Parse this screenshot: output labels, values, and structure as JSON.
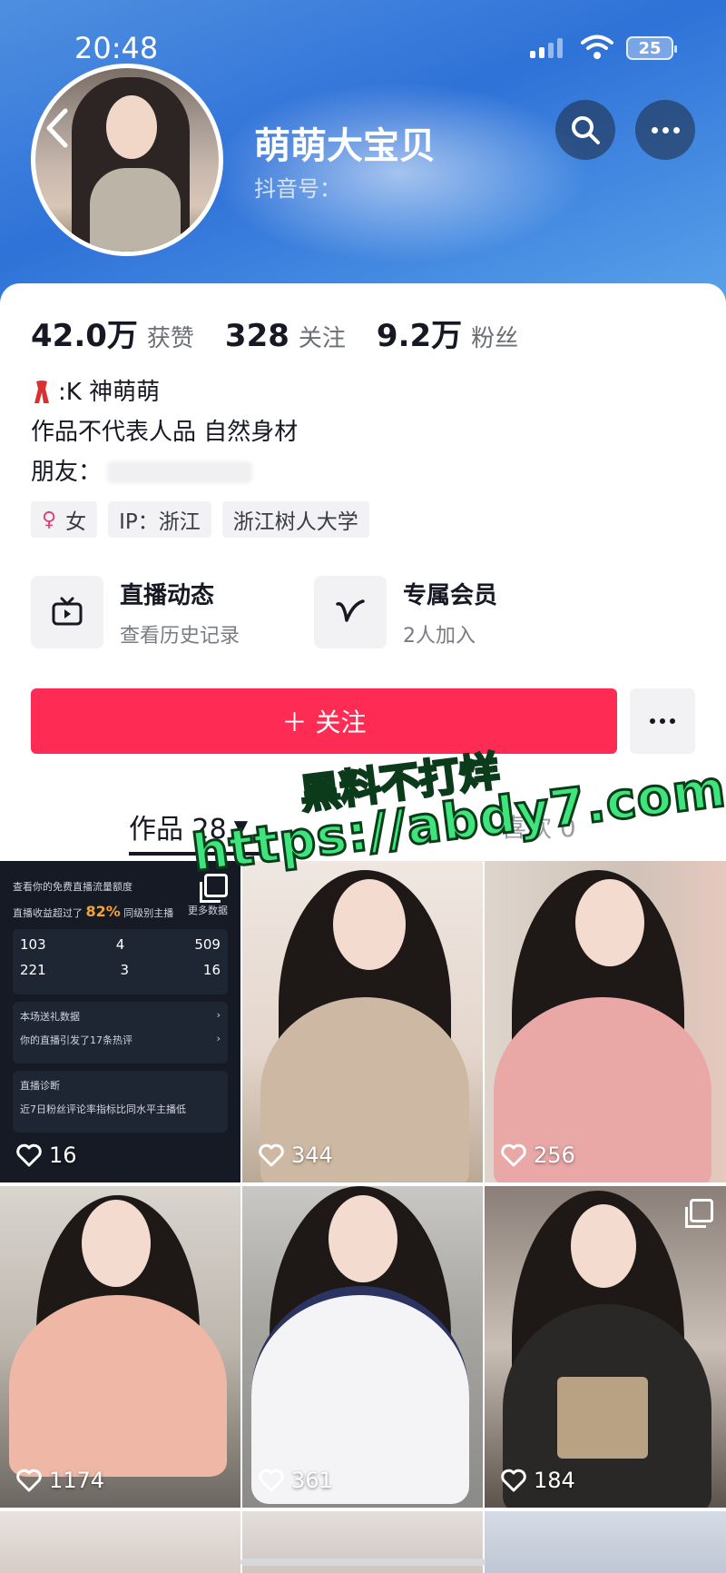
{
  "status": {
    "time": "20:48",
    "battery": "25"
  },
  "profile": {
    "nickname": "萌萌大宝贝",
    "douyin_id_label": "抖音号：",
    "stats": [
      {
        "value": "42.0万",
        "label": "获赞"
      },
      {
        "value": "328",
        "label": "关注"
      },
      {
        "value": "9.2万",
        "label": "粉丝"
      }
    ],
    "bio": [
      ":K 神萌萌",
      "作品不代表人品 自然身材",
      "朋友："
    ],
    "tags": [
      "女",
      "IP：浙江",
      "浙江树人大学"
    ],
    "features": [
      {
        "title": "直播动态",
        "sub": "查看历史记录",
        "icon": "tv-icon"
      },
      {
        "title": "专属会员",
        "sub": "2人加入",
        "icon": "v-icon"
      }
    ],
    "follow_label": "＋ 关注"
  },
  "tabs": {
    "works": "作品 28",
    "likes": "喜欢 0"
  },
  "watermark": {
    "line1": "黑料不打烊",
    "line2": "https://abdy7.com"
  },
  "grid_posts": [
    {
      "likes": "16",
      "type": "stats-screenshot"
    },
    {
      "likes": "344",
      "type": "photo"
    },
    {
      "likes": "256",
      "type": "photo"
    },
    {
      "likes": "1174",
      "type": "photo"
    },
    {
      "likes": "361",
      "type": "photo"
    },
    {
      "likes": "184",
      "type": "photo"
    }
  ],
  "live_stats_card": {
    "header": "查看你的免费直播流量额度",
    "income_prefix": "直播收益超过了",
    "income_pct": "82%",
    "income_suffix": "同级别主播",
    "more": "更多数据",
    "numbers": [
      "103",
      "4",
      "509",
      "221",
      "3",
      "16"
    ],
    "gift_row": "本场送礼数据",
    "comments_row": "你的直播引发了17条热评",
    "diagnosis": "直播诊断",
    "diagnosis_detail": "近7日粉丝评论率指标比同水平主播低"
  },
  "colors": {
    "accent": "#fe2c55",
    "banner": "#2f72d8",
    "watermark": "#3ee47c"
  }
}
